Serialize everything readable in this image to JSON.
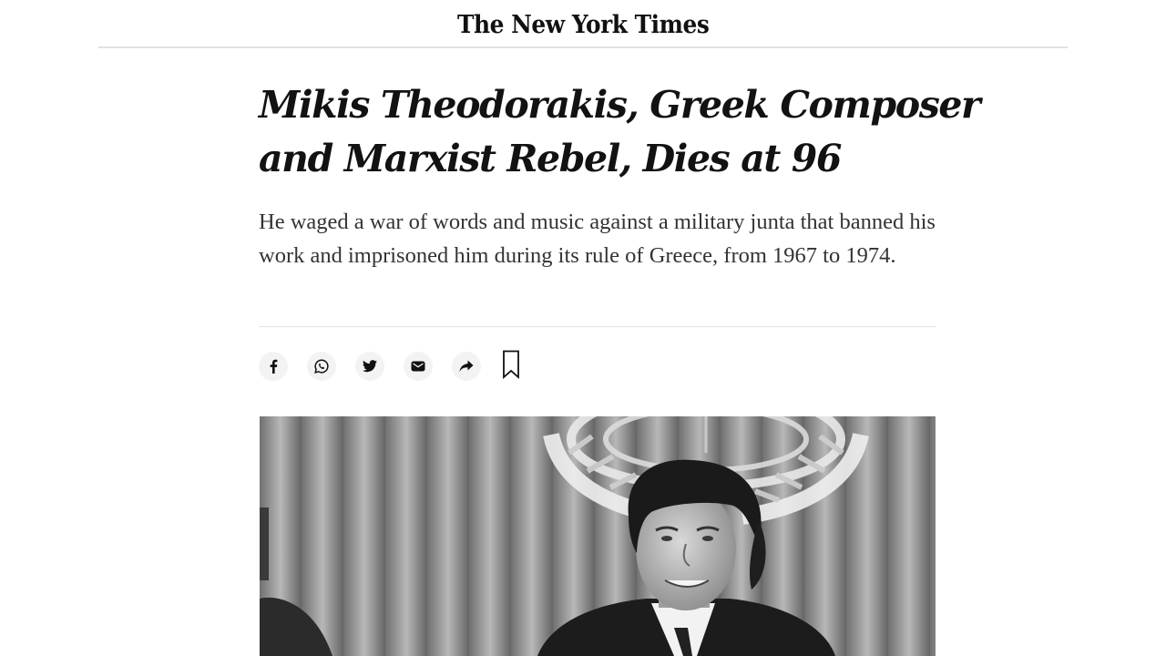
{
  "masthead": {
    "logo_text": "The New York Times"
  },
  "article": {
    "headline": "Mikis Theodorakis, Greek Composer and Marxist Rebel, Dies at 96",
    "summary": "He waged a war of words and music against a military junta that banned his work and imprisoned him during its rule of Greece, from 1967 to 1974."
  },
  "share_bar": {
    "buttons": [
      {
        "icon": "facebook-icon"
      },
      {
        "icon": "whatsapp-icon"
      },
      {
        "icon": "twitter-icon"
      },
      {
        "icon": "email-icon"
      },
      {
        "icon": "share-arrow-icon"
      },
      {
        "icon": "bookmark-icon"
      }
    ]
  },
  "photo": {
    "subject": "black-and-white photograph of a smiling man seated in front of the United Nations emblem"
  }
}
